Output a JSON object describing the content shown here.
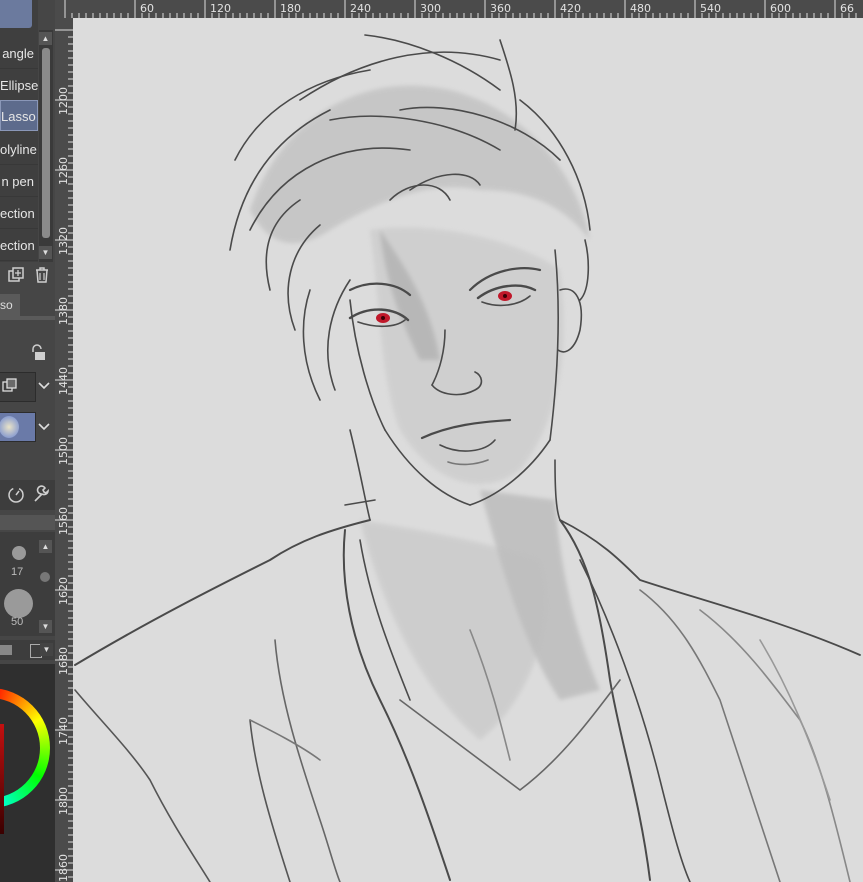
{
  "tools": {
    "items": [
      {
        "label": "angle",
        "selected": false
      },
      {
        "label": "Ellipse",
        "selected": false
      },
      {
        "label": "Lasso",
        "selected": true
      },
      {
        "label": "olyline",
        "selected": false
      },
      {
        "label": "n pen",
        "selected": false
      },
      {
        "label": "ection",
        "selected": false
      },
      {
        "label": "ection",
        "selected": false
      }
    ]
  },
  "subtool_tab": {
    "label": "so"
  },
  "brush_sizes": [
    "17",
    "50"
  ],
  "ruler": {
    "horizontal": [
      "60",
      "120",
      "180",
      "240",
      "300",
      "360",
      "420",
      "480",
      "540",
      "600",
      "66"
    ],
    "vertical": [
      "1200",
      "1260",
      "1320",
      "1380",
      "1440",
      "1500",
      "1560",
      "1620",
      "1680",
      "1740",
      "1800",
      "1860"
    ]
  },
  "colors": {
    "accent": "#5d6b8c",
    "canvas": "#dcdcdc",
    "eye": "#c0182a"
  },
  "icons": {
    "duplicate": "duplicate-icon",
    "trash": "trash-icon",
    "lock": "lock-icon",
    "dial": "dial-icon",
    "wrench": "wrench-icon"
  }
}
